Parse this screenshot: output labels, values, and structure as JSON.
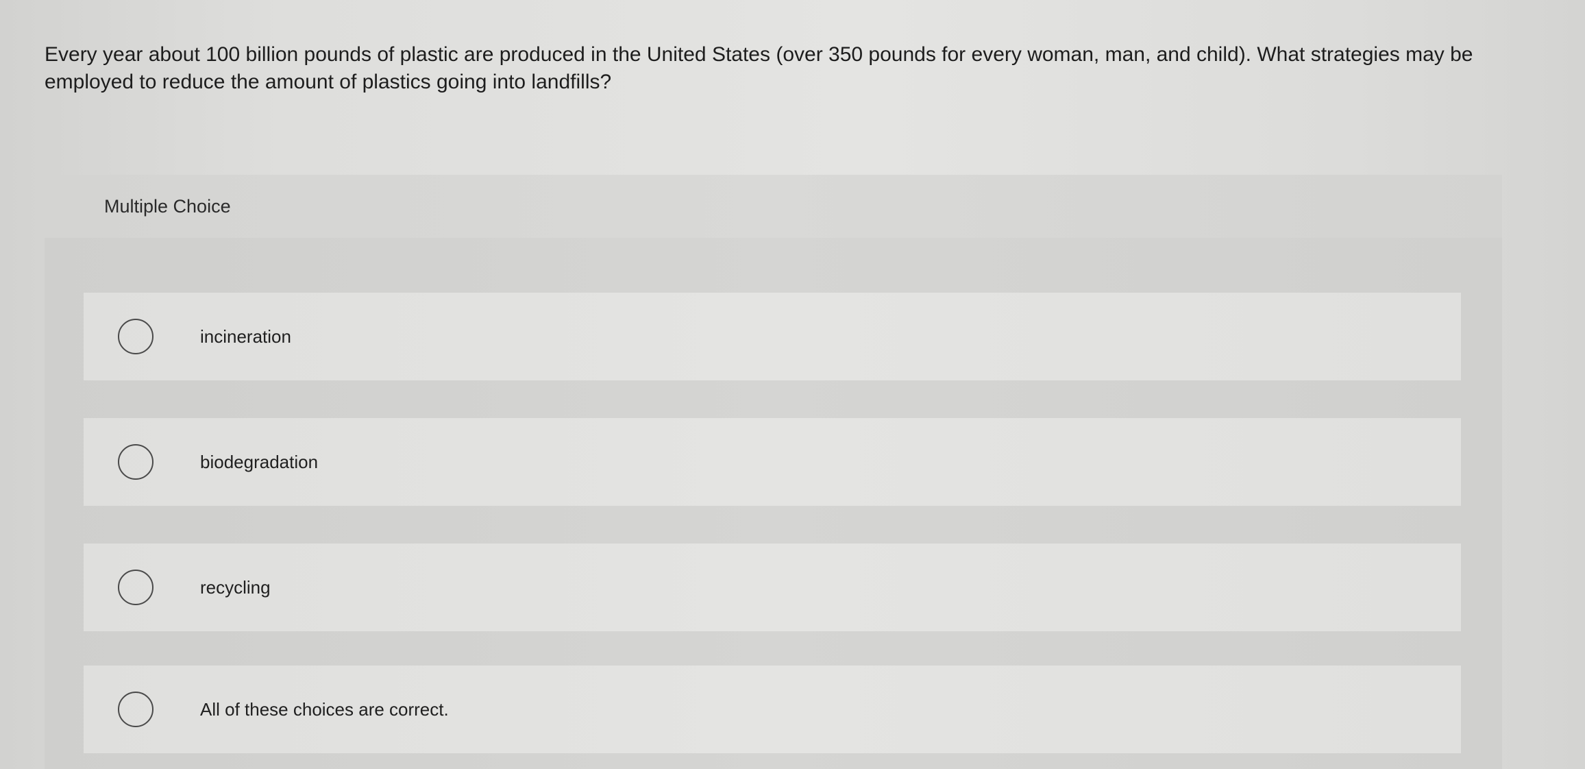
{
  "question": {
    "text": "Every year about 100 billion pounds of plastic are produced in the United States (over 350 pounds for every woman, man, and child). What strategies may be employed to reduce the amount of plastics going into landfills?"
  },
  "panel": {
    "title": "Multiple Choice",
    "options": [
      {
        "label": "incineration",
        "selected": false
      },
      {
        "label": "biodegradation",
        "selected": false
      },
      {
        "label": "recycling",
        "selected": false
      },
      {
        "label": "All of these choices are correct.",
        "selected": false
      }
    ]
  }
}
